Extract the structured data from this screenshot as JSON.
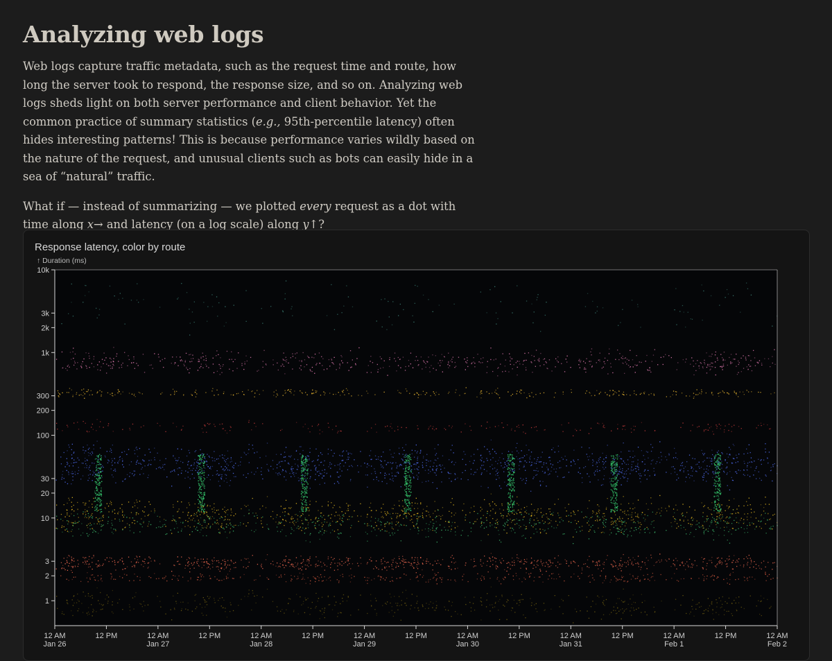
{
  "article": {
    "title": "Analyzing web logs",
    "p1": {
      "before": "Web logs capture traffic metadata, such as the request time and route, how long the server took to respond, the response size, and so on. Analyzing web logs sheds light on both server performance and client behavior. Yet the common practice of summary statistics (",
      "em": "e.g.,",
      "after": " 95th-percentile latency) often hides interesting patterns! This is because performance varies wildly based on the nature of the request, and unusual clients such as bots can easily hide in a sea of “natural” traffic."
    },
    "p2": {
      "a": "What if — instead of summarizing — we plotted ",
      "em1": "every",
      "b": " request as a dot with time along ",
      "em2": "x",
      "c": "→ and latency (on a log scale) along ",
      "em3": "y",
      "d": "↑?"
    }
  },
  "chart_data": {
    "type": "scatter",
    "title": "Response latency, color by route",
    "ylabel": "↑ Duration (ms)",
    "yscale": "log",
    "yticks": [
      {
        "value": 1,
        "label": "1"
      },
      {
        "value": 2,
        "label": "2"
      },
      {
        "value": 3,
        "label": "3"
      },
      {
        "value": 10,
        "label": "10"
      },
      {
        "value": 20,
        "label": "20"
      },
      {
        "value": 30,
        "label": "30"
      },
      {
        "value": 100,
        "label": "100"
      },
      {
        "value": 200,
        "label": "200"
      },
      {
        "value": 300,
        "label": "300"
      },
      {
        "value": 1000,
        "label": "1k"
      },
      {
        "value": 2000,
        "label": "2k"
      },
      {
        "value": 3000,
        "label": "3k"
      },
      {
        "value": 10000,
        "label": "10k"
      }
    ],
    "xlim": [
      "Jan 26 12 AM",
      "Feb 2 12 AM"
    ],
    "xticks": [
      {
        "hours": 0,
        "line1": "12 AM",
        "line2": "Jan 26"
      },
      {
        "hours": 12,
        "line1": "12 PM",
        "line2": ""
      },
      {
        "hours": 24,
        "line1": "12 AM",
        "line2": "Jan 27"
      },
      {
        "hours": 36,
        "line1": "12 PM",
        "line2": ""
      },
      {
        "hours": 48,
        "line1": "12 AM",
        "line2": "Jan 28"
      },
      {
        "hours": 60,
        "line1": "12 PM",
        "line2": ""
      },
      {
        "hours": 72,
        "line1": "12 AM",
        "line2": "Jan 29"
      },
      {
        "hours": 84,
        "line1": "12 PM",
        "line2": ""
      },
      {
        "hours": 96,
        "line1": "12 AM",
        "line2": "Jan 30"
      },
      {
        "hours": 108,
        "line1": "12 PM",
        "line2": ""
      },
      {
        "hours": 120,
        "line1": "12 AM",
        "line2": "Jan 31"
      },
      {
        "hours": 132,
        "line1": "12 PM",
        "line2": ""
      },
      {
        "hours": 144,
        "line1": "12 AM",
        "line2": "Feb 1"
      },
      {
        "hours": 156,
        "line1": "12 PM",
        "line2": ""
      },
      {
        "hours": 168,
        "line1": "12 AM",
        "line2": "Feb 2"
      }
    ],
    "bands": [
      {
        "lo": 500,
        "hi": 1200,
        "color": "#e07ab0",
        "density": 0.55
      },
      {
        "lo": 280,
        "hi": 380,
        "color": "#e8b530",
        "density": 0.45
      },
      {
        "lo": 100,
        "hi": 160,
        "color": "#c23a3a",
        "density": 0.25
      },
      {
        "lo": 22,
        "hi": 90,
        "color": "#4f6cf0",
        "density": 0.9
      },
      {
        "lo": 6,
        "hi": 20,
        "color": "#e0b520",
        "density": 0.7
      },
      {
        "lo": 5,
        "hi": 14,
        "color": "#3cb46a",
        "density": 0.5
      },
      {
        "lo": 2.2,
        "hi": 3.8,
        "color": "#f06a50",
        "density": 0.9
      },
      {
        "lo": 1.6,
        "hi": 2.3,
        "color": "#c9553c",
        "density": 0.5
      },
      {
        "lo": 0.55,
        "hi": 1.5,
        "color": "#6b5a10",
        "density": 0.4
      },
      {
        "lo": 1500,
        "hi": 10000,
        "color": "#3a7a70",
        "density": 0.08
      }
    ],
    "spikes_hours": [
      10,
      34,
      58,
      82,
      106,
      130,
      154
    ],
    "spike_color": "#34c26a",
    "background": "#050608",
    "axis_color": "#d8d8d8"
  }
}
